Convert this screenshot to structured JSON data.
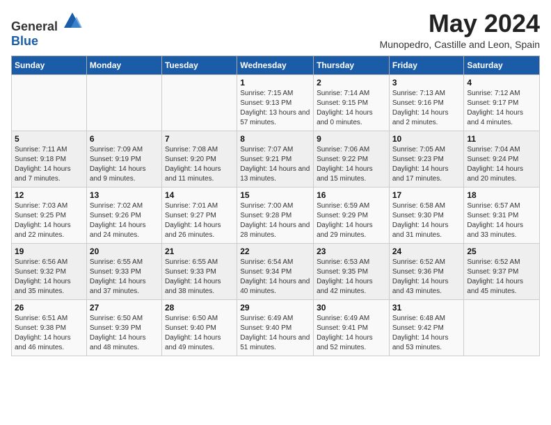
{
  "header": {
    "logo_general": "General",
    "logo_blue": "Blue",
    "month_title": "May 2024",
    "location": "Munopedro, Castille and Leon, Spain"
  },
  "weekdays": [
    "Sunday",
    "Monday",
    "Tuesday",
    "Wednesday",
    "Thursday",
    "Friday",
    "Saturday"
  ],
  "weeks": [
    [
      {
        "day": "",
        "sunrise": "",
        "sunset": "",
        "daylight": ""
      },
      {
        "day": "",
        "sunrise": "",
        "sunset": "",
        "daylight": ""
      },
      {
        "day": "",
        "sunrise": "",
        "sunset": "",
        "daylight": ""
      },
      {
        "day": "1",
        "sunrise": "Sunrise: 7:15 AM",
        "sunset": "Sunset: 9:13 PM",
        "daylight": "Daylight: 13 hours and 57 minutes."
      },
      {
        "day": "2",
        "sunrise": "Sunrise: 7:14 AM",
        "sunset": "Sunset: 9:15 PM",
        "daylight": "Daylight: 14 hours and 0 minutes."
      },
      {
        "day": "3",
        "sunrise": "Sunrise: 7:13 AM",
        "sunset": "Sunset: 9:16 PM",
        "daylight": "Daylight: 14 hours and 2 minutes."
      },
      {
        "day": "4",
        "sunrise": "Sunrise: 7:12 AM",
        "sunset": "Sunset: 9:17 PM",
        "daylight": "Daylight: 14 hours and 4 minutes."
      }
    ],
    [
      {
        "day": "5",
        "sunrise": "Sunrise: 7:11 AM",
        "sunset": "Sunset: 9:18 PM",
        "daylight": "Daylight: 14 hours and 7 minutes."
      },
      {
        "day": "6",
        "sunrise": "Sunrise: 7:09 AM",
        "sunset": "Sunset: 9:19 PM",
        "daylight": "Daylight: 14 hours and 9 minutes."
      },
      {
        "day": "7",
        "sunrise": "Sunrise: 7:08 AM",
        "sunset": "Sunset: 9:20 PM",
        "daylight": "Daylight: 14 hours and 11 minutes."
      },
      {
        "day": "8",
        "sunrise": "Sunrise: 7:07 AM",
        "sunset": "Sunset: 9:21 PM",
        "daylight": "Daylight: 14 hours and 13 minutes."
      },
      {
        "day": "9",
        "sunrise": "Sunrise: 7:06 AM",
        "sunset": "Sunset: 9:22 PM",
        "daylight": "Daylight: 14 hours and 15 minutes."
      },
      {
        "day": "10",
        "sunrise": "Sunrise: 7:05 AM",
        "sunset": "Sunset: 9:23 PM",
        "daylight": "Daylight: 14 hours and 17 minutes."
      },
      {
        "day": "11",
        "sunrise": "Sunrise: 7:04 AM",
        "sunset": "Sunset: 9:24 PM",
        "daylight": "Daylight: 14 hours and 20 minutes."
      }
    ],
    [
      {
        "day": "12",
        "sunrise": "Sunrise: 7:03 AM",
        "sunset": "Sunset: 9:25 PM",
        "daylight": "Daylight: 14 hours and 22 minutes."
      },
      {
        "day": "13",
        "sunrise": "Sunrise: 7:02 AM",
        "sunset": "Sunset: 9:26 PM",
        "daylight": "Daylight: 14 hours and 24 minutes."
      },
      {
        "day": "14",
        "sunrise": "Sunrise: 7:01 AM",
        "sunset": "Sunset: 9:27 PM",
        "daylight": "Daylight: 14 hours and 26 minutes."
      },
      {
        "day": "15",
        "sunrise": "Sunrise: 7:00 AM",
        "sunset": "Sunset: 9:28 PM",
        "daylight": "Daylight: 14 hours and 28 minutes."
      },
      {
        "day": "16",
        "sunrise": "Sunrise: 6:59 AM",
        "sunset": "Sunset: 9:29 PM",
        "daylight": "Daylight: 14 hours and 29 minutes."
      },
      {
        "day": "17",
        "sunrise": "Sunrise: 6:58 AM",
        "sunset": "Sunset: 9:30 PM",
        "daylight": "Daylight: 14 hours and 31 minutes."
      },
      {
        "day": "18",
        "sunrise": "Sunrise: 6:57 AM",
        "sunset": "Sunset: 9:31 PM",
        "daylight": "Daylight: 14 hours and 33 minutes."
      }
    ],
    [
      {
        "day": "19",
        "sunrise": "Sunrise: 6:56 AM",
        "sunset": "Sunset: 9:32 PM",
        "daylight": "Daylight: 14 hours and 35 minutes."
      },
      {
        "day": "20",
        "sunrise": "Sunrise: 6:55 AM",
        "sunset": "Sunset: 9:33 PM",
        "daylight": "Daylight: 14 hours and 37 minutes."
      },
      {
        "day": "21",
        "sunrise": "Sunrise: 6:55 AM",
        "sunset": "Sunset: 9:33 PM",
        "daylight": "Daylight: 14 hours and 38 minutes."
      },
      {
        "day": "22",
        "sunrise": "Sunrise: 6:54 AM",
        "sunset": "Sunset: 9:34 PM",
        "daylight": "Daylight: 14 hours and 40 minutes."
      },
      {
        "day": "23",
        "sunrise": "Sunrise: 6:53 AM",
        "sunset": "Sunset: 9:35 PM",
        "daylight": "Daylight: 14 hours and 42 minutes."
      },
      {
        "day": "24",
        "sunrise": "Sunrise: 6:52 AM",
        "sunset": "Sunset: 9:36 PM",
        "daylight": "Daylight: 14 hours and 43 minutes."
      },
      {
        "day": "25",
        "sunrise": "Sunrise: 6:52 AM",
        "sunset": "Sunset: 9:37 PM",
        "daylight": "Daylight: 14 hours and 45 minutes."
      }
    ],
    [
      {
        "day": "26",
        "sunrise": "Sunrise: 6:51 AM",
        "sunset": "Sunset: 9:38 PM",
        "daylight": "Daylight: 14 hours and 46 minutes."
      },
      {
        "day": "27",
        "sunrise": "Sunrise: 6:50 AM",
        "sunset": "Sunset: 9:39 PM",
        "daylight": "Daylight: 14 hours and 48 minutes."
      },
      {
        "day": "28",
        "sunrise": "Sunrise: 6:50 AM",
        "sunset": "Sunset: 9:40 PM",
        "daylight": "Daylight: 14 hours and 49 minutes."
      },
      {
        "day": "29",
        "sunrise": "Sunrise: 6:49 AM",
        "sunset": "Sunset: 9:40 PM",
        "daylight": "Daylight: 14 hours and 51 minutes."
      },
      {
        "day": "30",
        "sunrise": "Sunrise: 6:49 AM",
        "sunset": "Sunset: 9:41 PM",
        "daylight": "Daylight: 14 hours and 52 minutes."
      },
      {
        "day": "31",
        "sunrise": "Sunrise: 6:48 AM",
        "sunset": "Sunset: 9:42 PM",
        "daylight": "Daylight: 14 hours and 53 minutes."
      },
      {
        "day": "",
        "sunrise": "",
        "sunset": "",
        "daylight": ""
      }
    ]
  ]
}
